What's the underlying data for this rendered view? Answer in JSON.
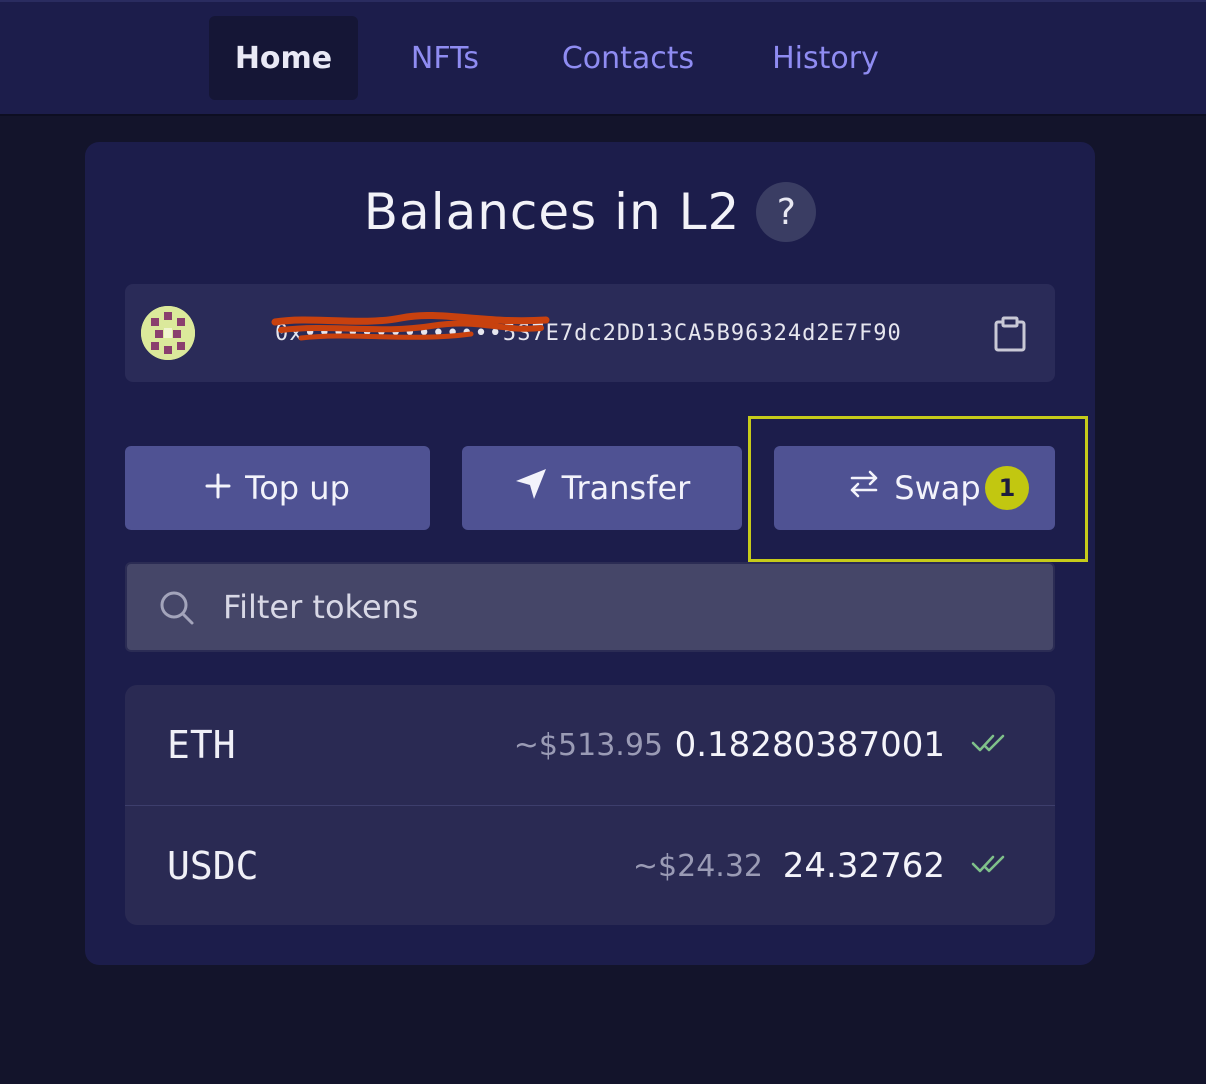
{
  "nav": {
    "tabs": [
      {
        "label": "Home",
        "active": true
      },
      {
        "label": "NFTs",
        "active": false
      },
      {
        "label": "Contacts",
        "active": false
      },
      {
        "label": "History",
        "active": false
      }
    ]
  },
  "card": {
    "title": "Balances in L2",
    "help_symbol": "?",
    "address": {
      "text": "0x••••••••••••••5S7E7dc2DD13CA5B96324d2E7F90",
      "redacted_note": "partially scribbled"
    },
    "actions": {
      "top_up": "Top up",
      "transfer": "Transfer",
      "swap": "Swap",
      "swap_badge": "1"
    },
    "search": {
      "placeholder": "Filter tokens"
    },
    "tokens": [
      {
        "symbol": "ETH",
        "usd": "~$513.95",
        "amount": "0.18280387001"
      },
      {
        "symbol": "USDC",
        "usd": "~$24.32",
        "amount": "24.32762"
      }
    ]
  },
  "colors": {
    "accent": "#4f5293",
    "highlight": "#c6cb1a",
    "nav_text": "#8f8cf2",
    "check": "#7fc08a"
  },
  "icons": [
    "plus-icon",
    "send-icon",
    "swap-arrows-icon",
    "search-icon",
    "clipboard-icon",
    "double-check-icon",
    "question-icon"
  ]
}
